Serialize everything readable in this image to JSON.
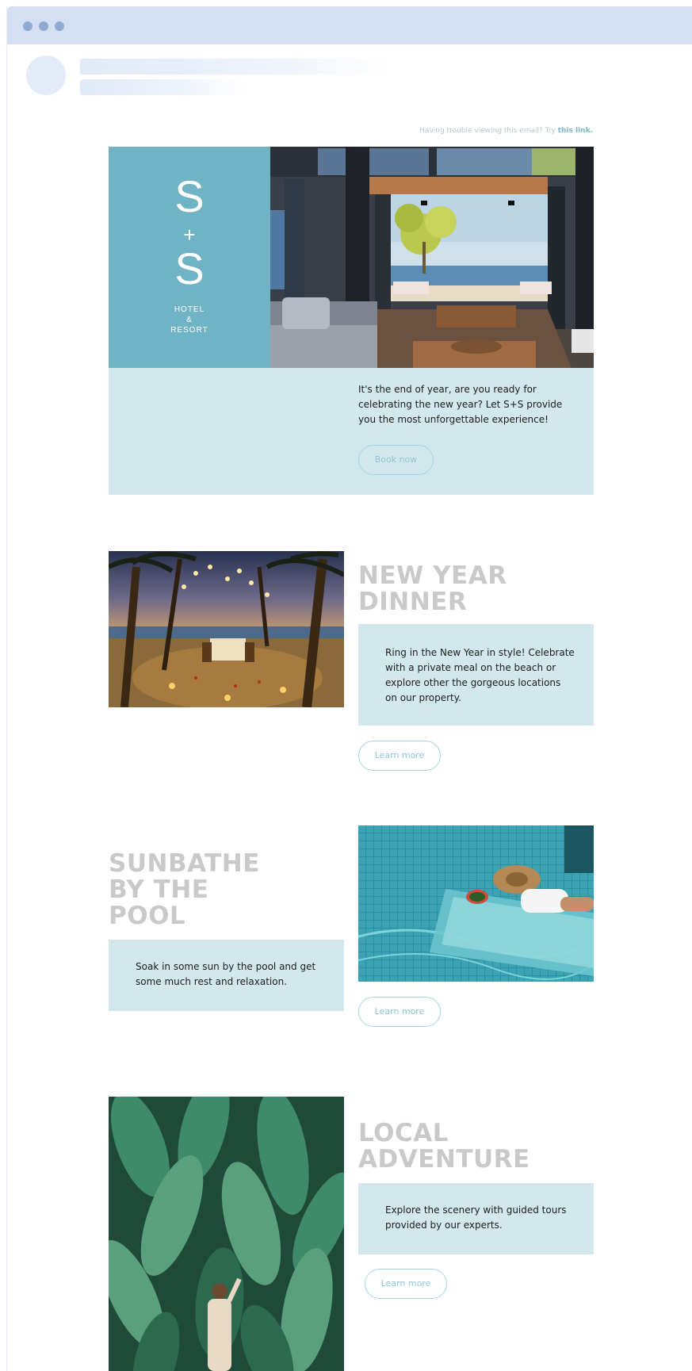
{
  "header_notice": {
    "text": "Having trouble viewing this email? Try",
    "link": "this link."
  },
  "hero": {
    "logo_top": "S",
    "logo_plus": "+",
    "logo_bottom": "S",
    "logo_sub_1": "HOTEL",
    "logo_sub_2": "&",
    "logo_sub_3": "RESORT",
    "text": "It's the end of year, are you ready for celebrating the new year? Let S+S provide you the most unforgettable experience!",
    "button": "Book now"
  },
  "sections": [
    {
      "heading_1": "NEW YEAR",
      "heading_2": "DINNER",
      "text": "Ring in the New Year in style! Celebrate with a private meal on the beach or explore other the gorgeous locations on our property.",
      "button": "Learn more"
    },
    {
      "heading_1": "SUNBATHE",
      "heading_2": "BY THE",
      "heading_3": "POOL",
      "text": "Soak in some sun by the pool and get some much rest and relaxation.",
      "button": "Learn more"
    },
    {
      "heading_1": "LOCAL",
      "heading_2": "ADVENTURE",
      "text": "Explore the scenery with guided tours provided by our experts.",
      "button": "Learn more"
    }
  ],
  "colors": {
    "browser_bar": "#d3e0f4",
    "logo_panel": "#6fb3c4",
    "text_panel": "#d2e8ec",
    "heading": "#c9c9c9",
    "button_border": "#a9d4df"
  }
}
